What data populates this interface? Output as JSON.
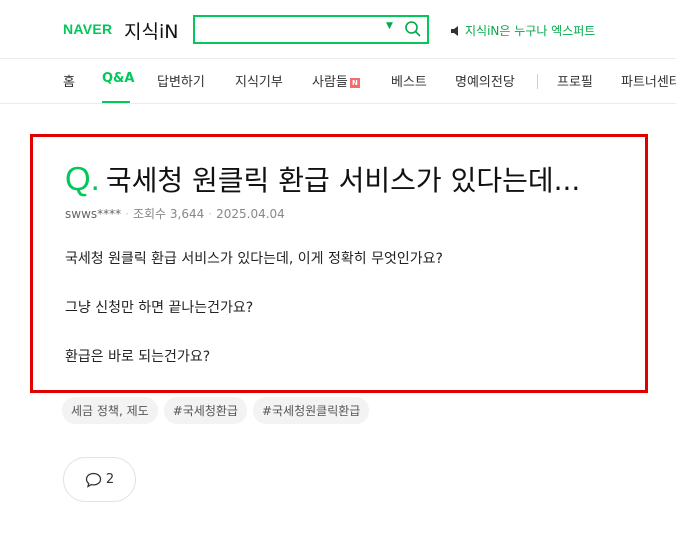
{
  "header": {
    "logo_brand": "NAVER",
    "logo_service": "지식iN",
    "search": {
      "value": "",
      "placeholder": ""
    },
    "slogan": "지식iN은 누구나 엑스퍼트"
  },
  "nav": {
    "items": [
      {
        "label": "홈"
      },
      {
        "label": "Q&A",
        "active": true
      },
      {
        "label": "답변하기"
      },
      {
        "label": "지식기부"
      },
      {
        "label": "사람들",
        "badge": "N"
      },
      {
        "label": "베스트"
      },
      {
        "label": "명예의전당"
      },
      {
        "label": "프로필"
      },
      {
        "label": "파트너센터"
      }
    ]
  },
  "question": {
    "mark": "Q.",
    "title": "국세청 원클릭 환급 서비스가 있다는데...",
    "author": "swws****",
    "views": "조회수 3,644",
    "date": "2025.04.04",
    "body": [
      "국세청 원클릭 환급 서비스가 있다는데, 이게 정확히 무엇인가요?",
      "그냥 신청만 하면 끝나는건가요?",
      "환급은 바로 되는건가요?"
    ]
  },
  "tags": [
    "세금 정책, 제도",
    "#국세청환급",
    "#국세청원클릭환급"
  ],
  "comments": {
    "count": "2"
  },
  "colors": {
    "accent": "#03c75a",
    "highlight_border": "#e00000"
  }
}
